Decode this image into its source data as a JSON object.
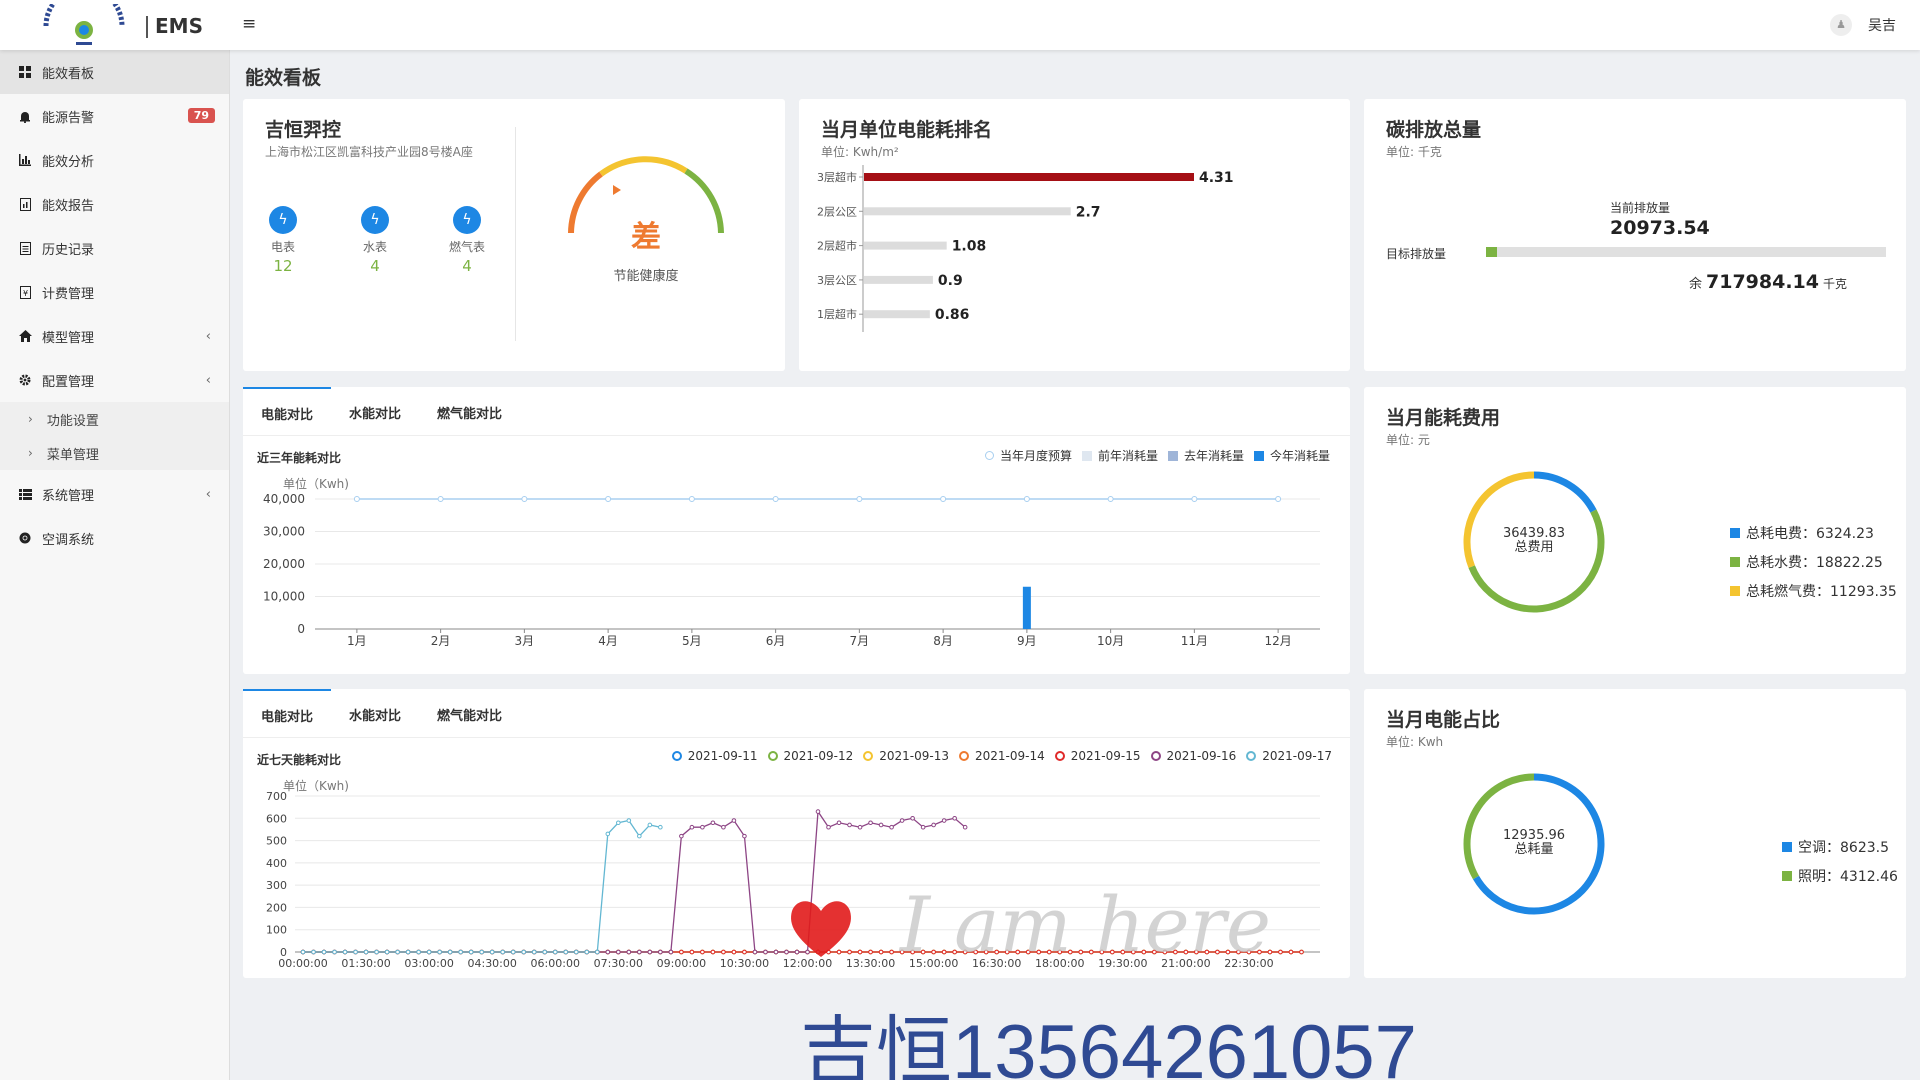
{
  "app": {
    "brand": "EMS",
    "logo_alt": "上海吉恒电气设备有限公司",
    "user": "吴吉"
  },
  "nav": [
    {
      "label": "能效看板",
      "icon": "grid-icon",
      "active": true
    },
    {
      "label": "能源告警",
      "icon": "bell-icon",
      "badge": "79"
    },
    {
      "label": "能效分析",
      "icon": "bar-chart-icon"
    },
    {
      "label": "能效报告",
      "icon": "report-icon"
    },
    {
      "label": "历史记录",
      "icon": "history-icon"
    },
    {
      "label": "计费管理",
      "icon": "billing-icon"
    },
    {
      "label": "模型管理",
      "icon": "home-icon",
      "chevron": "‹"
    },
    {
      "label": "配置管理",
      "icon": "gear-icon",
      "chevron": "‹"
    },
    {
      "label": "系统管理",
      "icon": "list-icon",
      "chevron": "‹"
    },
    {
      "label": "空调系统",
      "icon": "chrome-icon"
    }
  ],
  "subnav": [
    {
      "label": "功能设置"
    },
    {
      "label": "菜单管理"
    }
  ],
  "page_title": "能效看板",
  "company": {
    "name": "吉恒羿控",
    "address": "上海市松江区凯富科技产业园8号楼A座",
    "meters": [
      {
        "label": "电表",
        "value": "12"
      },
      {
        "label": "水表",
        "value": "4"
      },
      {
        "label": "燃气表",
        "value": "4"
      }
    ],
    "gauge": {
      "grade": "差",
      "label": "节能健康度"
    }
  },
  "ranking": {
    "title": "当月单位电能耗排名",
    "unit": "单位: Kwh/m²"
  },
  "carbon": {
    "title": "碳排放总量",
    "unit": "单位: 千克",
    "current_label": "当前排放量",
    "current_value": "20973.54",
    "target_label": "目标排放量",
    "remain_prefix": "余",
    "remain_value": "717984.14",
    "remain_unit": "千克",
    "progress": 0.028
  },
  "tabs": [
    "电能对比",
    "水能对比",
    "燃气能对比"
  ],
  "yearly": {
    "title": "近三年能耗对比",
    "unit": "单位（Kwh)",
    "legend": [
      "当年月度预算",
      "前年消耗量",
      "去年消耗量",
      "今年消耗量"
    ]
  },
  "weekly": {
    "title": "近七天能耗对比",
    "unit": "单位（Kwh)"
  },
  "cost": {
    "title": "当月能耗费用",
    "unit": "单位: 元",
    "center_value": "36439.83",
    "center_label": "总费用",
    "items": [
      {
        "label": "总耗电费：6324.23",
        "color": "#1d87e4"
      },
      {
        "label": "总耗水费：18822.25",
        "color": "#7cb342"
      },
      {
        "label": "总耗燃气费：11293.35",
        "color": "#f4c430"
      }
    ]
  },
  "elec": {
    "title": "当月电能占比",
    "unit": "单位: Kwh",
    "center_value": "12935.96",
    "center_label": "总耗量",
    "items": [
      {
        "label": "空调：8623.5",
        "color": "#1d87e4"
      },
      {
        "label": "照明：4312.46",
        "color": "#7cb342"
      }
    ]
  },
  "watermark": "吉恒13564261057",
  "handwriting": "I am here",
  "chart_data": [
    {
      "type": "bar",
      "title": "当月单位电能耗排名",
      "categories": [
        "3层超市",
        "2层公区",
        "2层超市",
        "3层公区",
        "1层超市"
      ],
      "values": [
        4.31,
        2.7,
        1.08,
        0.9,
        0.86
      ]
    },
    {
      "type": "bar",
      "title": "近三年能耗对比",
      "ylabel": "单位（Kwh)",
      "ylim": [
        0,
        40000
      ],
      "categories": [
        "1月",
        "2月",
        "3月",
        "4月",
        "5月",
        "6月",
        "7月",
        "8月",
        "9月",
        "10月",
        "11月",
        "12月"
      ],
      "yticks": [
        "40,000",
        "30,000",
        "20,000",
        "10,000",
        "0"
      ],
      "series": [
        {
          "name": "当年月度预算",
          "type": "line",
          "color": "#a8cff0",
          "values": [
            40000,
            40000,
            40000,
            40000,
            40000,
            40000,
            40000,
            40000,
            40000,
            40000,
            40000,
            40000
          ]
        },
        {
          "name": "今年消耗量",
          "color": "#1d87e4",
          "values": [
            0,
            0,
            0,
            0,
            0,
            0,
            0,
            0,
            13000,
            0,
            0,
            0
          ]
        }
      ],
      "legend_colors": [
        "#a8cff0",
        "#dfe7f0",
        "#9fb5d8",
        "#1d87e4"
      ]
    },
    {
      "type": "line",
      "title": "近七天能耗对比",
      "ylabel": "单位（Kwh)",
      "ylim": [
        0,
        700
      ],
      "yticks": [
        "700",
        "600",
        "500",
        "400",
        "300",
        "200",
        "100",
        "0"
      ],
      "xticks": [
        "00:00:00",
        "01:30:00",
        "03:00:00",
        "04:30:00",
        "06:00:00",
        "07:30:00",
        "09:00:00",
        "10:30:00",
        "12:00:00",
        "13:30:00",
        "15:00:00",
        "16:30:00",
        "18:00:00",
        "19:30:00",
        "21:00:00",
        "22:30:00"
      ],
      "series": [
        {
          "name": "2021-09-11",
          "color": "#1d87e4"
        },
        {
          "name": "2021-09-12",
          "color": "#7cb342"
        },
        {
          "name": "2021-09-13",
          "color": "#f4c430"
        },
        {
          "name": "2021-09-14",
          "color": "#ee7a30"
        },
        {
          "name": "2021-09-15",
          "color": "#e02a2a"
        },
        {
          "name": "2021-09-16",
          "color": "#8d4585"
        },
        {
          "name": "2021-09-17",
          "color": "#63b7d2"
        }
      ]
    }
  ]
}
